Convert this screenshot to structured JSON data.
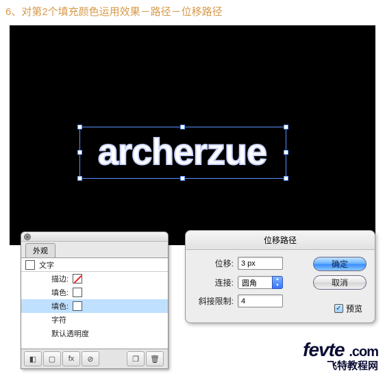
{
  "caption": "6、对第2个填充颜色运用效果－路径－位移路径",
  "artboard_text": "archerzue",
  "appearance": {
    "tab": "外观",
    "header_label": "文字",
    "rows": [
      {
        "label": "描边:",
        "swatch": "none"
      },
      {
        "label": "填色:",
        "swatch": "white"
      },
      {
        "label": "填色:",
        "swatch": "white",
        "selected": true
      },
      {
        "label": "字符",
        "swatch": ""
      },
      {
        "label": "默认透明度",
        "swatch": ""
      }
    ]
  },
  "dialog": {
    "title": "位移路径",
    "offset_label": "位移:",
    "offset_value": "3 px",
    "joins_label": "连接:",
    "joins_value": "圆角",
    "miter_label": "斜接限制:",
    "miter_value": "4",
    "ok": "确定",
    "cancel": "取消",
    "preview_label": "预览"
  },
  "brand": {
    "top": "fevte",
    "com": ".com",
    "sub": "飞特教程网"
  }
}
